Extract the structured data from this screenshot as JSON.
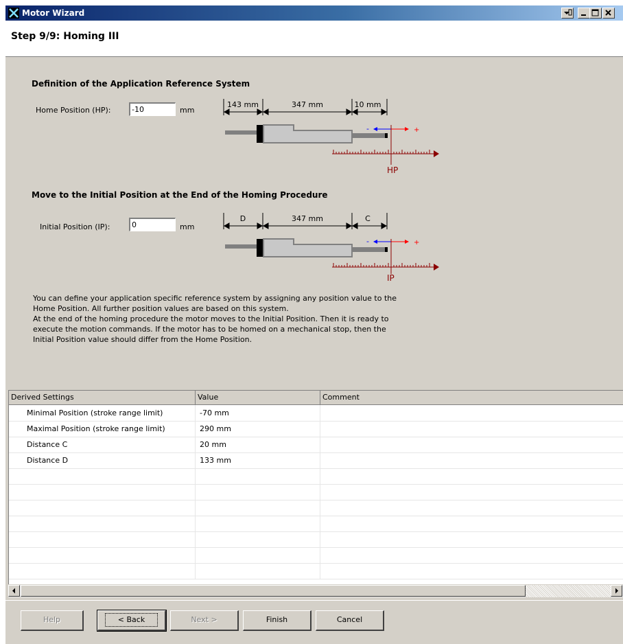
{
  "window": {
    "title": "Motor Wizard"
  },
  "header": {
    "step_title": "Step 9/9: Homing III"
  },
  "section_reference": {
    "title": "Definition of the Application Reference System",
    "field_label": "Home Position (HP):",
    "field_value": "-10",
    "unit": "mm",
    "diagram": {
      "left_dim": "143 mm",
      "mid_dim": "347 mm",
      "right_dim": "10 mm",
      "marker": "HP",
      "minus": "-",
      "plus": "+"
    }
  },
  "section_initial": {
    "title": "Move to the Initial Position at the End of the Homing Procedure",
    "field_label": "Initial Position (IP):",
    "field_value": "0",
    "unit": "mm",
    "diagram": {
      "left_dim": "D",
      "mid_dim": "347 mm",
      "right_dim": "C",
      "marker": "IP",
      "minus": "-",
      "plus": "+"
    }
  },
  "description": [
    "You can define your application specific reference system by assigning any position value to the",
    "Home Position. All further position values are  based on this system.",
    "At the end of the homing procedure the motor moves to the Initial Position. Then it is ready to",
    "execute the motion commands. If the motor has to be homed on a mechanical stop, then the",
    "Initial Position value should differ from the Home Position."
  ],
  "grid": {
    "headers": [
      "Derived Settings",
      "Value",
      "Comment"
    ],
    "rows": [
      [
        "Minimal Position (stroke range limit)",
        "-70 mm",
        ""
      ],
      [
        "Maximal Position (stroke range limit)",
        "290 mm",
        ""
      ],
      [
        "Distance C",
        "20 mm",
        ""
      ],
      [
        "Distance D",
        "133 mm",
        ""
      ]
    ]
  },
  "buttons": {
    "help": "Help",
    "back": "< Back",
    "next": "Next >",
    "finish": "Finish",
    "cancel": "Cancel"
  },
  "colors": {
    "title_start": "#0a246a",
    "title_end": "#a6caf0",
    "window_bg": "#d4d0c8",
    "marker_red": "#8b0000",
    "arrow_blue": "#0000ff",
    "arrow_red": "#ff0000"
  },
  "icons": [
    "app-icon",
    "restore-icon",
    "minimize-icon",
    "maximize-icon",
    "close-icon",
    "scroll-left-icon",
    "scroll-right-icon"
  ]
}
